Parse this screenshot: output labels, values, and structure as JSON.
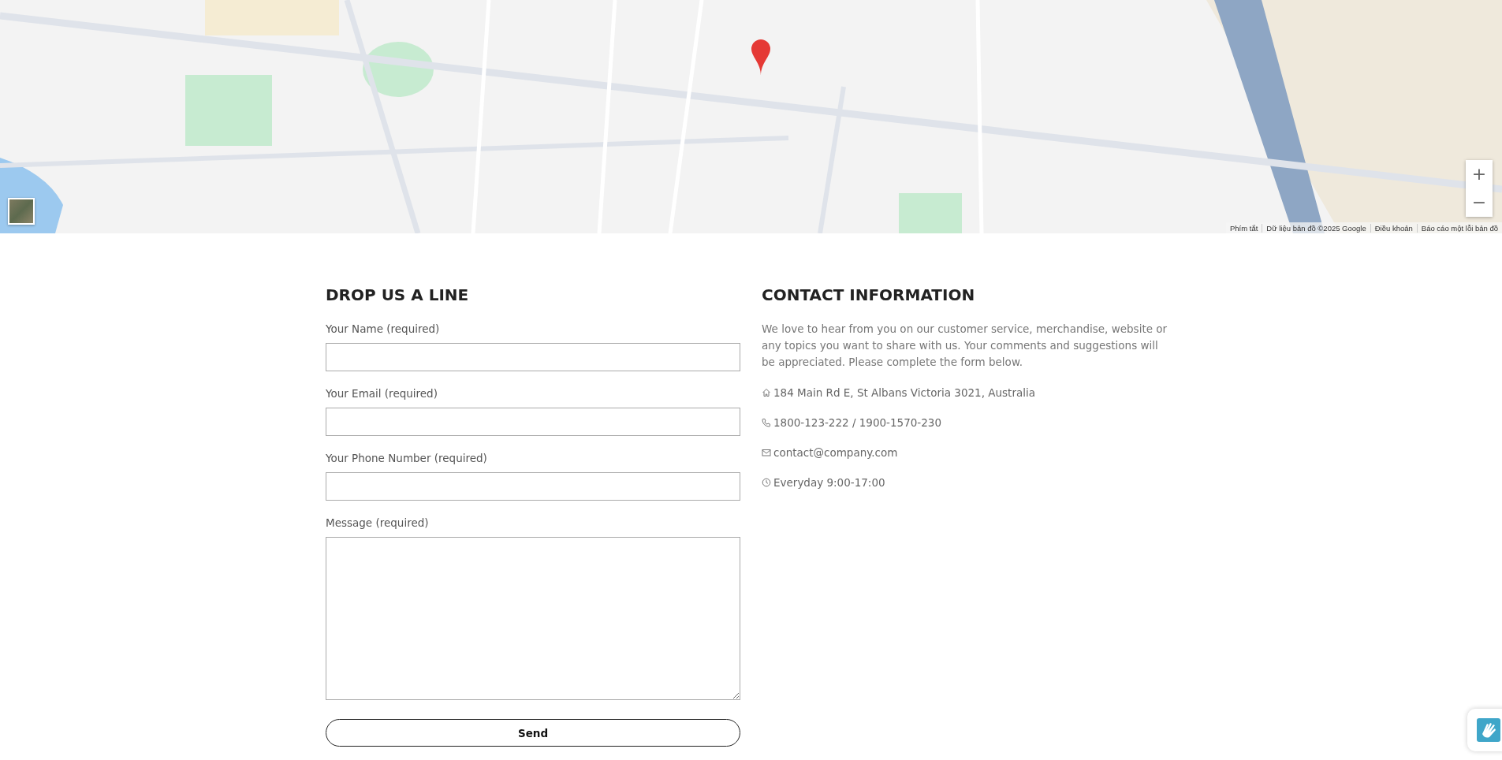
{
  "map": {
    "kind": "picture",
    "zoom_controls": [
      "+",
      "−"
    ],
    "attribution": [
      "Phím tắt",
      "Dữ liệu bản đồ ©2025 Google",
      "Điều khoản",
      "Báo cáo một lỗi bản đồ"
    ]
  },
  "form": {
    "title": "DROP US A LINE",
    "fields": [
      {
        "label": "Your Name (required)",
        "kind": "input"
      },
      {
        "label": "Your Email (required)",
        "kind": "input"
      },
      {
        "label": "Your Phone Number (required)",
        "kind": "input"
      },
      {
        "label": "Message (required)",
        "kind": "textarea"
      }
    ],
    "submit": "Send"
  },
  "contact": {
    "title": "CONTACT INFORMATION",
    "intro": "We love to hear from you on our customer service, merchandise, website or any topics you want to share with us. Your comments and suggestions will be appreciated. Please complete the form below.",
    "items": [
      {
        "kind": "address",
        "text": "184 Main Rd E, St Albans Victoria 3021, Australia"
      },
      {
        "kind": "phone",
        "text": "1800-123-222 / 1900-1570-230"
      },
      {
        "kind": "email",
        "text": "contact@company.com"
      },
      {
        "kind": "hours",
        "text": "Everyday 9:00-17:00"
      }
    ]
  }
}
